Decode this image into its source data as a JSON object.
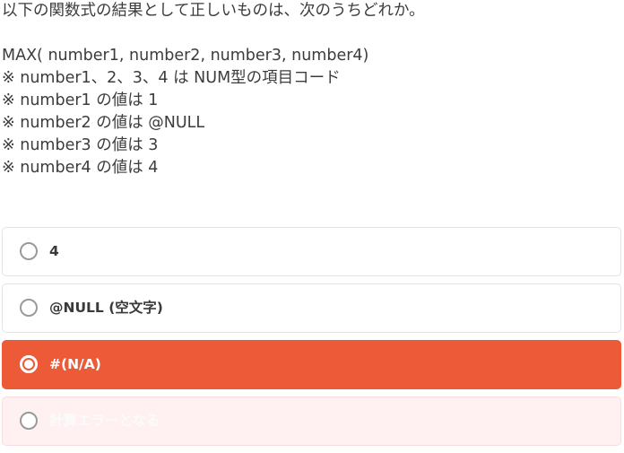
{
  "question": {
    "prompt": "以下の関数式の結果として正しいものは、次のうちどれか。",
    "formula": "MAX( number1, number2, number3, number4)",
    "notes": [
      "※ number1、2、3、4 は NUM型の項目コード",
      "※ number1 の値は 1",
      "※ number2 の値は @NULL",
      "※ number3 の値は 3",
      "※ number4 の値は 4"
    ]
  },
  "options": [
    {
      "label": "4",
      "state": "unselected"
    },
    {
      "label": "@NULL (空文字)",
      "state": "unselected"
    },
    {
      "label": "#(N/A)",
      "state": "selected"
    },
    {
      "label": "計算エラーとなる",
      "state": "faded"
    }
  ],
  "colors": {
    "accent": "#ec5a37",
    "faded_bg": "#fff1f1",
    "border": "#e3e3e3"
  }
}
